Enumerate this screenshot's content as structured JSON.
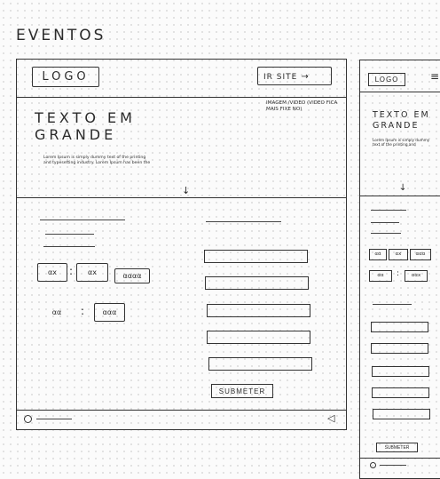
{
  "page": {
    "title": "EVENTOS"
  },
  "desktop": {
    "header": {
      "logo": "LOGO",
      "ir_site": "IR SITE",
      "ir_site_arrow": "→"
    },
    "hero": {
      "title": "TEXTO   EM\nGRANDE",
      "body": "Lorem Ipsum is simply dummy text of the printing and typesetting industry. Lorem Ipsum has been the",
      "media_note": "IMAGEM /VIDEO (VIDEO FICA MAIS FIXE NO)",
      "scroll_icon": "↓"
    },
    "filters": {
      "row1": [
        "αx",
        ":",
        "αx",
        "αααα"
      ],
      "row2": [
        "αα",
        ":",
        "ααα"
      ]
    },
    "form": {
      "submit": "SUBMETER"
    },
    "footer": {
      "back_icon": "◁"
    }
  },
  "mobile": {
    "header": {
      "logo": "LOGO",
      "menu_icon": "≡"
    },
    "hero": {
      "title": "TEXTO  EM\nGRANDE",
      "body": "Lorem Ipsum is simply dummy text of the printing and",
      "scroll_icon": "↓"
    },
    "filters": {
      "row1": [
        "αα",
        ":",
        "αx",
        "ααα"
      ],
      "row2": [
        "αα",
        ":",
        "ααx"
      ]
    },
    "form": {
      "submit": "SUBMETER"
    }
  }
}
